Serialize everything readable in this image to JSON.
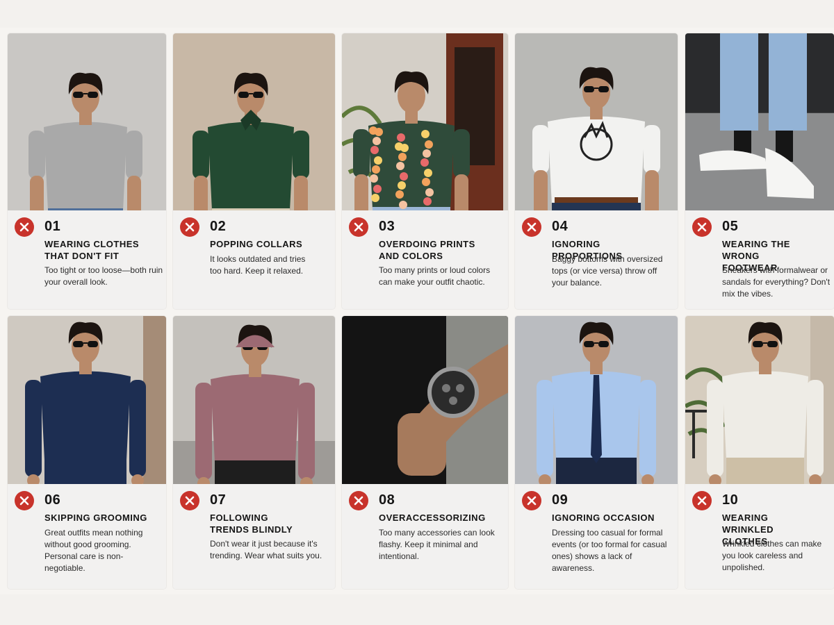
{
  "mistakes": [
    {
      "number": "01",
      "title": "WEARING CLOTHES THAT DON'T FIT",
      "description": "Too tight or too loose—both ruin your overall look.",
      "icon": "x-circle-icon",
      "scene": "grey-tshirt-jeans"
    },
    {
      "number": "02",
      "title": "POPPING COLLARS",
      "description": "It looks outdated and tries too hard. Keep it relaxed.",
      "icon": "x-circle-icon",
      "scene": "green-polo-popped-collar"
    },
    {
      "number": "03",
      "title": "OVERDOING PRINTS AND COLORS",
      "description": "Too many prints or loud colors can make your outfit chaotic.",
      "icon": "x-circle-icon",
      "scene": "floral-print-shirt"
    },
    {
      "number": "04",
      "title": "IGNORING PROPORTIONS",
      "description": "Baggy bottoms with oversized tops (or vice versa) throw off your balance.",
      "icon": "x-circle-icon",
      "scene": "oversized-graphic-tee"
    },
    {
      "number": "05",
      "title": "WEARING THE WRONG FOOTWEAR",
      "description": "Sneakers with formalwear or sandals for everything? Don't mix the vibes.",
      "icon": "x-circle-icon",
      "scene": "white-sneakers-jeans"
    },
    {
      "number": "06",
      "title": "SKIPPING GROOMING",
      "description": "Great outfits mean nothing without good grooming. Personal care is non-negotiable.",
      "icon": "x-circle-icon",
      "scene": "navy-shirt"
    },
    {
      "number": "07",
      "title": "FOLLOWING TRENDS BLINDLY",
      "description": "Don't wear it just because it's trending. Wear what suits you.",
      "icon": "x-circle-icon",
      "scene": "mauve-hoodie-cargo"
    },
    {
      "number": "08",
      "title": "OVERACCESSORIZING",
      "description": "Too many accessories can look flashy. Keep it minimal and intentional.",
      "icon": "x-circle-icon",
      "scene": "chunky-wristwatch"
    },
    {
      "number": "09",
      "title": "IGNORING OCCASION",
      "description": "Dressing too casual for formal events (or too formal for casual ones) shows a lack of awareness.",
      "icon": "x-circle-icon",
      "scene": "blue-shirt-tie"
    },
    {
      "number": "10",
      "title": "WEARING WRINKLED CLOTHES",
      "description": "Wrinkled clothes can make you look careless and unpolished.",
      "icon": "x-circle-icon",
      "scene": "wrinkled-white-linen-shirt"
    }
  ],
  "colors": {
    "x_icon": "#c8332b",
    "card_bg": "#f2f1ef",
    "text": "#151515"
  }
}
